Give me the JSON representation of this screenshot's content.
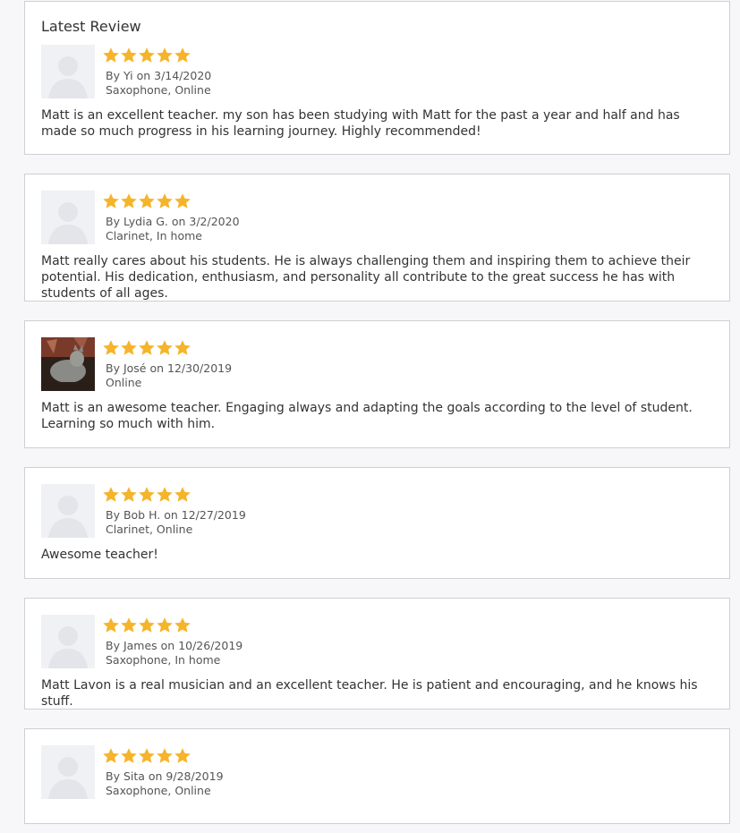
{
  "header": {
    "title": "Latest Review"
  },
  "colors": {
    "star": "#f5b42a",
    "border": "#cfcfd4",
    "avatar_bg": "#f0f1f4"
  },
  "reviews": [
    {
      "rating": 5,
      "byline": "By Yi on 3/14/2020",
      "detail": "Saxophone, Online",
      "text": "Matt is an excellent teacher. my son has been studying with Matt for the past a year and half and has made so much progress in his learning journey. Highly recommended!",
      "avatar": "default-avatar-icon"
    },
    {
      "rating": 5,
      "byline": "By Lydia G. on 3/2/2020",
      "detail": "Clarinet, In home",
      "text": "Matt really cares about his students. He is always challenging them and inspiring them to achieve their potential. His dedication, enthusiasm, and personality all contribute to the great success he has with students of all ages.",
      "avatar": "default-avatar-icon"
    },
    {
      "rating": 5,
      "byline": "By José on 12/30/2019",
      "detail": "Online",
      "text": "Matt is an awesome teacher. Engaging always and adapting the goals according to the level of student. Learning so much with him.",
      "avatar": "photo-avatar"
    },
    {
      "rating": 5,
      "byline": "By Bob H. on 12/27/2019",
      "detail": "Clarinet, Online",
      "text": "Awesome teacher!",
      "avatar": "default-avatar-icon"
    },
    {
      "rating": 5,
      "byline": "By James on 10/26/2019",
      "detail": "Saxophone, In home",
      "text": "Matt Lavon is a real musician and an excellent teacher. He is patient and encouraging, and he knows his stuff.",
      "avatar": "default-avatar-icon"
    },
    {
      "rating": 5,
      "byline": "By Sita on 9/28/2019",
      "detail": "Saxophone, Online",
      "text": "",
      "avatar": "default-avatar-icon"
    }
  ]
}
